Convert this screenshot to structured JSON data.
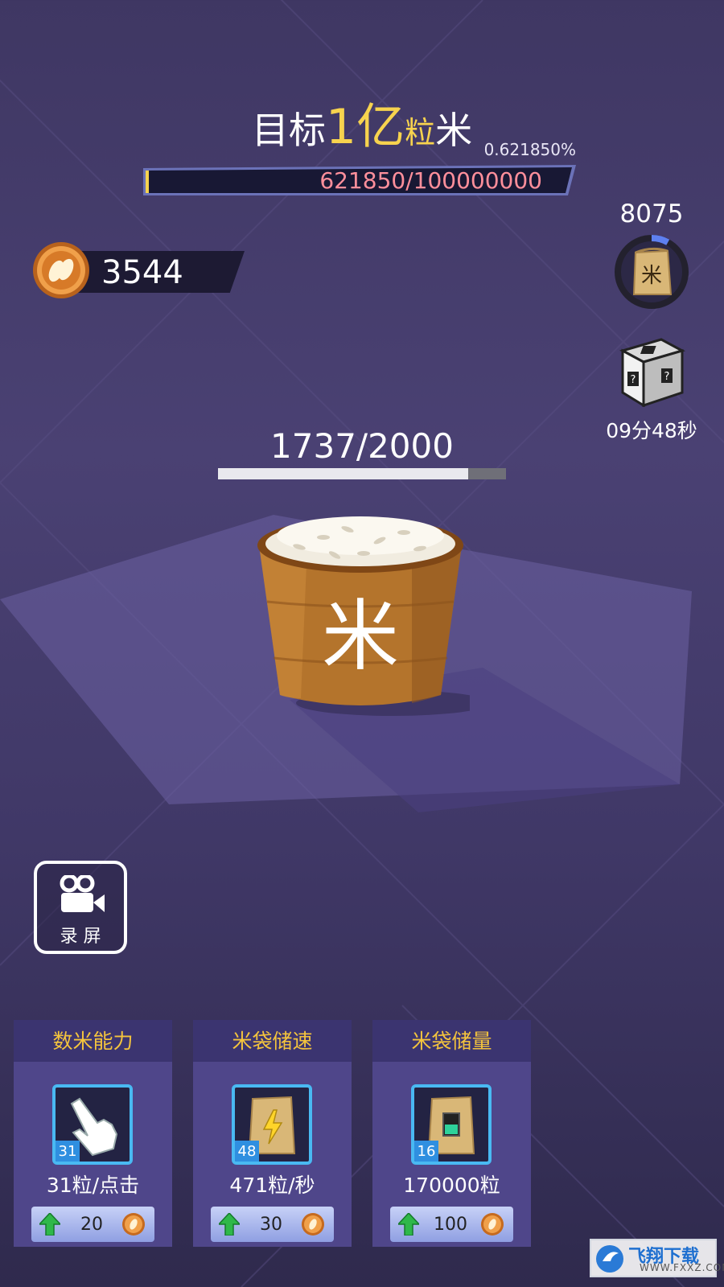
{
  "goal": {
    "prefix": "目标",
    "number": "1",
    "unit_yi": "亿",
    "unit_li": "粒",
    "suffix": "米",
    "percent": "0.621850%",
    "progress_text": "621850/100000000",
    "progress_fraction": 0.0062185
  },
  "coins": {
    "value": "3544",
    "icon": "rice-coin-icon"
  },
  "rice_bag": {
    "count": "8075",
    "label": "米",
    "timer_fraction": 0.08
  },
  "mystery_box": {
    "timer": "09分48秒",
    "icon": "mystery-box-icon"
  },
  "capacity": {
    "text": "1737/2000",
    "fraction": 0.8685
  },
  "bucket": {
    "label": "米"
  },
  "record": {
    "label": "录 屏",
    "icon": "video-camera-icon"
  },
  "upgrades": [
    {
      "title": "数米能力",
      "level": "31",
      "stat": "31粒/点击",
      "cost": "20",
      "icon": "tap-hand-icon"
    },
    {
      "title": "米袋储速",
      "level": "48",
      "stat": "471粒/秒",
      "cost": "30",
      "icon": "bag-speed-icon"
    },
    {
      "title": "米袋储量",
      "level": "16",
      "stat": "170000粒",
      "cost": "100",
      "icon": "bag-capacity-icon"
    }
  ],
  "watermark": {
    "brand": "飞翔下载",
    "site": "WWW.FXXZ.COM"
  },
  "colors": {
    "gold": "#f7d34e",
    "card": "#4f468a",
    "accent_blue": "#49b9f2",
    "progress_red": "#ff8f9b"
  }
}
